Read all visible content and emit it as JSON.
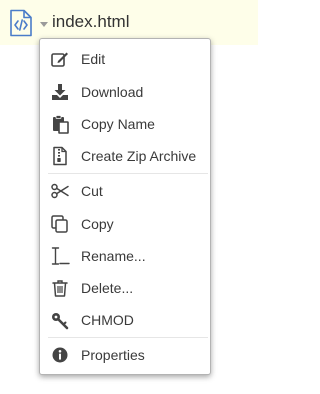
{
  "file": {
    "icon": "html-file-icon",
    "name": "index.html"
  },
  "menu": {
    "items": [
      {
        "label": "Edit",
        "icon": "edit-icon"
      },
      {
        "label": "Download",
        "icon": "download-icon"
      },
      {
        "label": "Copy Name",
        "icon": "clipboard-icon"
      },
      {
        "label": "Create Zip Archive",
        "icon": "zip-file-icon"
      },
      {
        "label": "Cut",
        "icon": "scissors-icon"
      },
      {
        "label": "Copy",
        "icon": "copy-icon"
      },
      {
        "label": "Rename...",
        "icon": "text-cursor-icon"
      },
      {
        "label": "Delete...",
        "icon": "trash-icon"
      },
      {
        "label": "CHMOD",
        "icon": "key-icon"
      },
      {
        "label": "Properties",
        "icon": "info-icon"
      }
    ]
  },
  "colors": {
    "bar_background": "#fefee9",
    "file_icon": "#4a7cc9",
    "menu_icon": "#444444",
    "text": "#3a3a3a"
  }
}
